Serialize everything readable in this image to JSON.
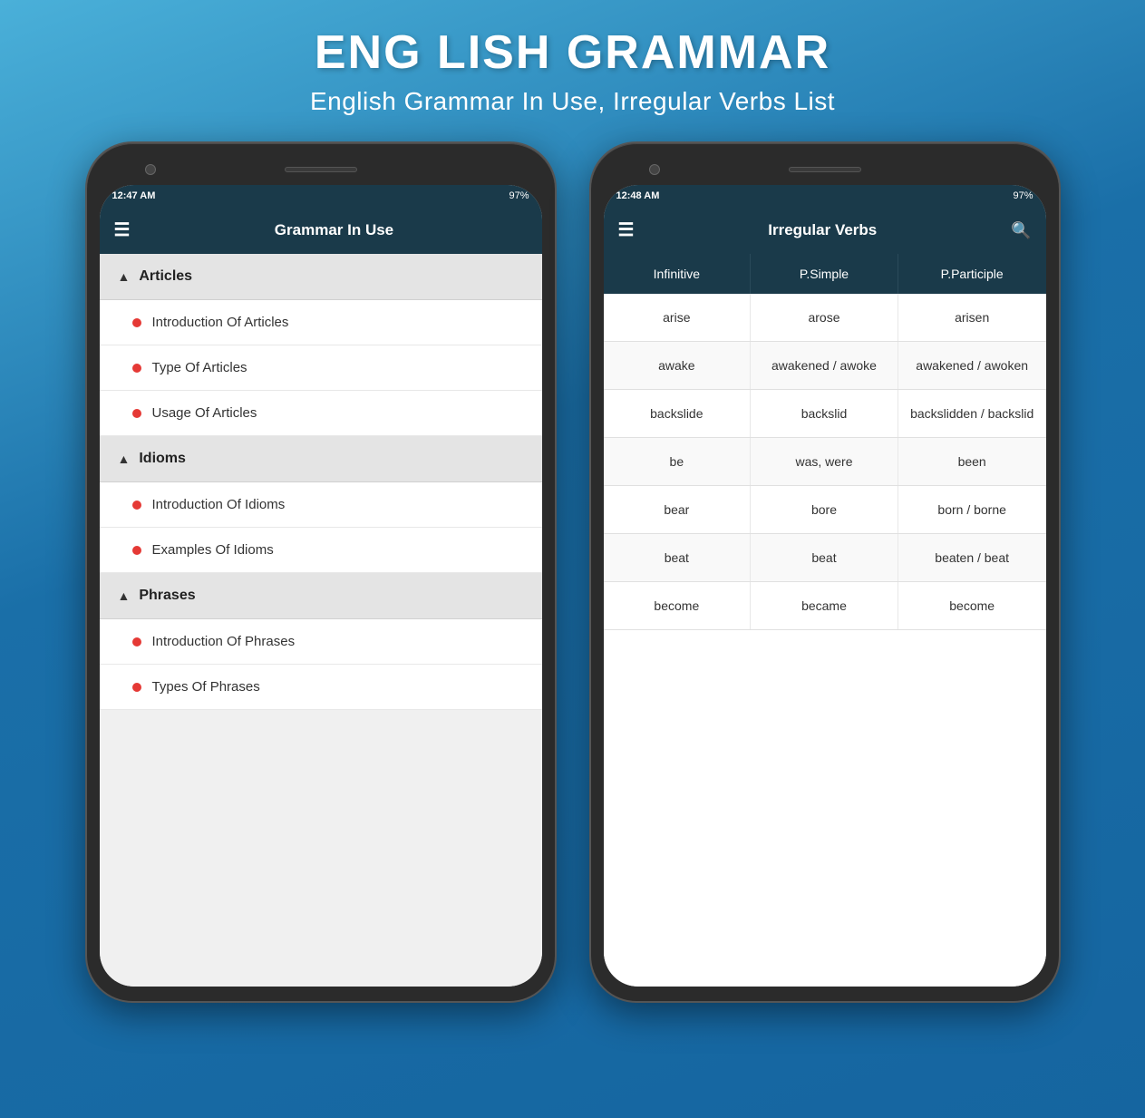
{
  "header": {
    "main_title": "ENG LISH GRAMMAR",
    "sub_title": "English Grammar In Use, Irregular Verbs List"
  },
  "left_phone": {
    "status": {
      "time": "12:47 AM",
      "battery": "97%"
    },
    "app_bar": {
      "title": "Grammar In Use"
    },
    "sections": [
      {
        "name": "Articles",
        "items": [
          "Introduction Of Articles",
          "Type Of Articles",
          "Usage Of Articles"
        ]
      },
      {
        "name": "Idioms",
        "items": [
          "Introduction Of Idioms",
          "Examples Of Idioms"
        ]
      },
      {
        "name": "Phrases",
        "items": [
          "Introduction Of Phrases",
          "Types Of Phrases"
        ]
      }
    ]
  },
  "right_phone": {
    "status": {
      "time": "12:48 AM",
      "battery": "97%"
    },
    "app_bar": {
      "title": "Irregular Verbs"
    },
    "table": {
      "headers": [
        "Infinitive",
        "P.Simple",
        "P.Participle"
      ],
      "rows": [
        [
          "arise",
          "arose",
          "arisen"
        ],
        [
          "awake",
          "awakened / awoke",
          "awakened / awoken"
        ],
        [
          "backslide",
          "backslid",
          "backslidden / backslid"
        ],
        [
          "be",
          "was, were",
          "been"
        ],
        [
          "bear",
          "bore",
          "born / borne"
        ],
        [
          "beat",
          "beat",
          "beaten / beat"
        ],
        [
          "become",
          "became",
          "become"
        ]
      ]
    }
  }
}
